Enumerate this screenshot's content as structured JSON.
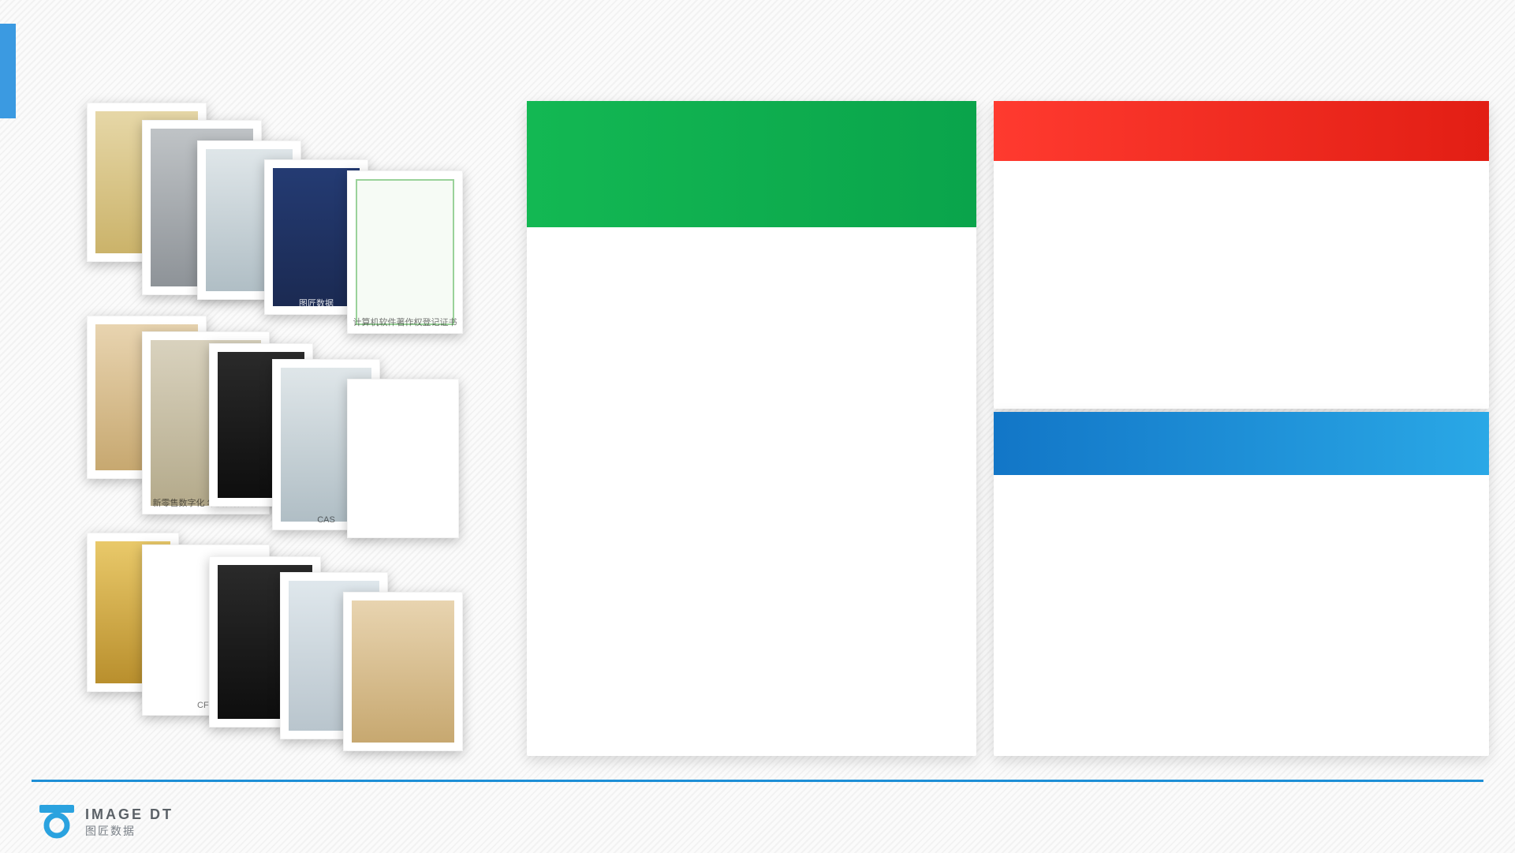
{
  "accent": {
    "color": "#3b9ae1"
  },
  "cards": {
    "green": {
      "header_color": "#13b853"
    },
    "red": {
      "header_color": "#ff3a2f"
    },
    "blue": {
      "header_color": "#1276c7"
    }
  },
  "collage": {
    "items": [
      {
        "name": "certificate-gold-framed",
        "caption": ""
      },
      {
        "name": "plaque-grey",
        "caption": ""
      },
      {
        "name": "glass-trophy",
        "caption": ""
      },
      {
        "name": "cfs-backdrop",
        "caption": "图匠数据"
      },
      {
        "name": "software-copyright-cert",
        "caption": "计算机软件著作权登记证书"
      },
      {
        "name": "framed-certificate",
        "caption": ""
      },
      {
        "name": "award-plaque-retail",
        "caption": "新零售数字化\n年度合作伙伴"
      },
      {
        "name": "dark-award",
        "caption": ""
      },
      {
        "name": "cas-trophy",
        "caption": "CAS"
      },
      {
        "name": "gov-filing-certificate",
        "caption": ""
      },
      {
        "name": "gold-trophy",
        "caption": ""
      },
      {
        "name": "cfs-panel",
        "caption": "CFS"
      },
      {
        "name": "black-plaque",
        "caption": ""
      },
      {
        "name": "photo-office",
        "caption": ""
      },
      {
        "name": "framed-certificate-2",
        "caption": ""
      }
    ]
  },
  "footer": {
    "brand_en": "IMAGE DT",
    "brand_cn": "图匠数据"
  },
  "page_label": ""
}
